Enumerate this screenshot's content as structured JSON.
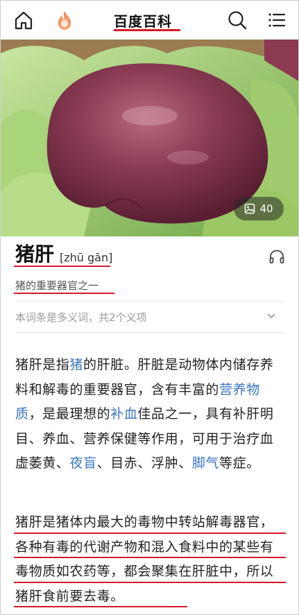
{
  "header": {
    "logo": "百度百科",
    "icons": [
      "home-icon",
      "fire-icon",
      "search-icon",
      "menu-icon"
    ]
  },
  "hero": {
    "photo_count": "40"
  },
  "entry": {
    "title": "猪肝",
    "pinyin": "[zhū gān]",
    "subtitle": "猪的重要器官之一",
    "polysemy": "本词条是多义词，共2个义项"
  },
  "paragraph1": {
    "t1": "猪肝是指",
    "l1": "猪",
    "t2": "的肝脏。肝脏是动物体内储存养料和解毒的重要器官，含有丰富的",
    "l2": "营养物质",
    "t3": "，是最理想的",
    "l3": "补血",
    "t4": "佳品之一，具有补肝明目、养血、营养保健等作用，可用于治疗血虚萎黄、",
    "l4": "夜盲",
    "t5": "、目赤、浮肿、",
    "l5": "脚气",
    "t6": "等症。"
  },
  "paragraph2": {
    "text": "猪肝是猪体内最大的毒物中转站解毒器官，各种有毒的代谢产物和混入食料中的某些有毒物质如农药等，都会聚集在肝脏中，所以猪肝食前要去毒。"
  },
  "colors": {
    "accent_red": "#d7182a",
    "link_blue": "#3a74c2"
  }
}
